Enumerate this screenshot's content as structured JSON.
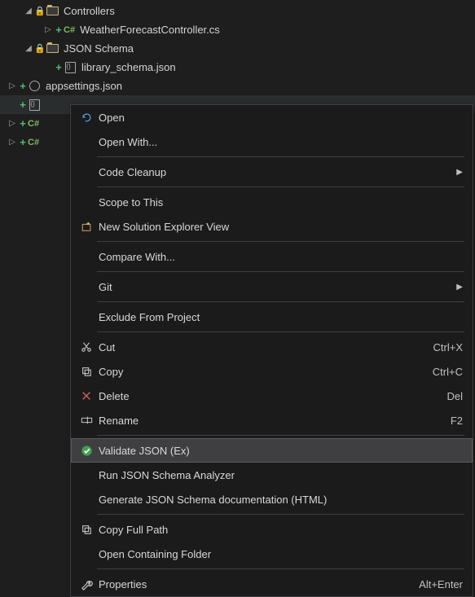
{
  "tree": {
    "controllers": "Controllers",
    "weather": "WeatherForecastController.cs",
    "jsonSchema": "JSON Schema",
    "libSchema": "library_schema.json",
    "appsettings": "appsettings.json",
    "csBadge": "C#"
  },
  "menu": {
    "open": "Open",
    "openWith": "Open With...",
    "codeCleanup": "Code Cleanup",
    "scopeToThis": "Scope to This",
    "newSolutionExplorer": "New Solution Explorer View",
    "compareWith": "Compare With...",
    "git": "Git",
    "excludeFromProject": "Exclude From Project",
    "cut": "Cut",
    "copy": "Copy",
    "delete": "Delete",
    "rename": "Rename",
    "validateJson": "Validate JSON (Ex)",
    "runAnalyzer": "Run JSON Schema Analyzer",
    "generateDoc": "Generate JSON Schema documentation (HTML)",
    "copyFullPath": "Copy Full Path",
    "openFolder": "Open Containing Folder",
    "properties": "Properties"
  },
  "shortcut": {
    "cut": "Ctrl+X",
    "copy": "Ctrl+C",
    "delete": "Del",
    "rename": "F2",
    "properties": "Alt+Enter"
  }
}
